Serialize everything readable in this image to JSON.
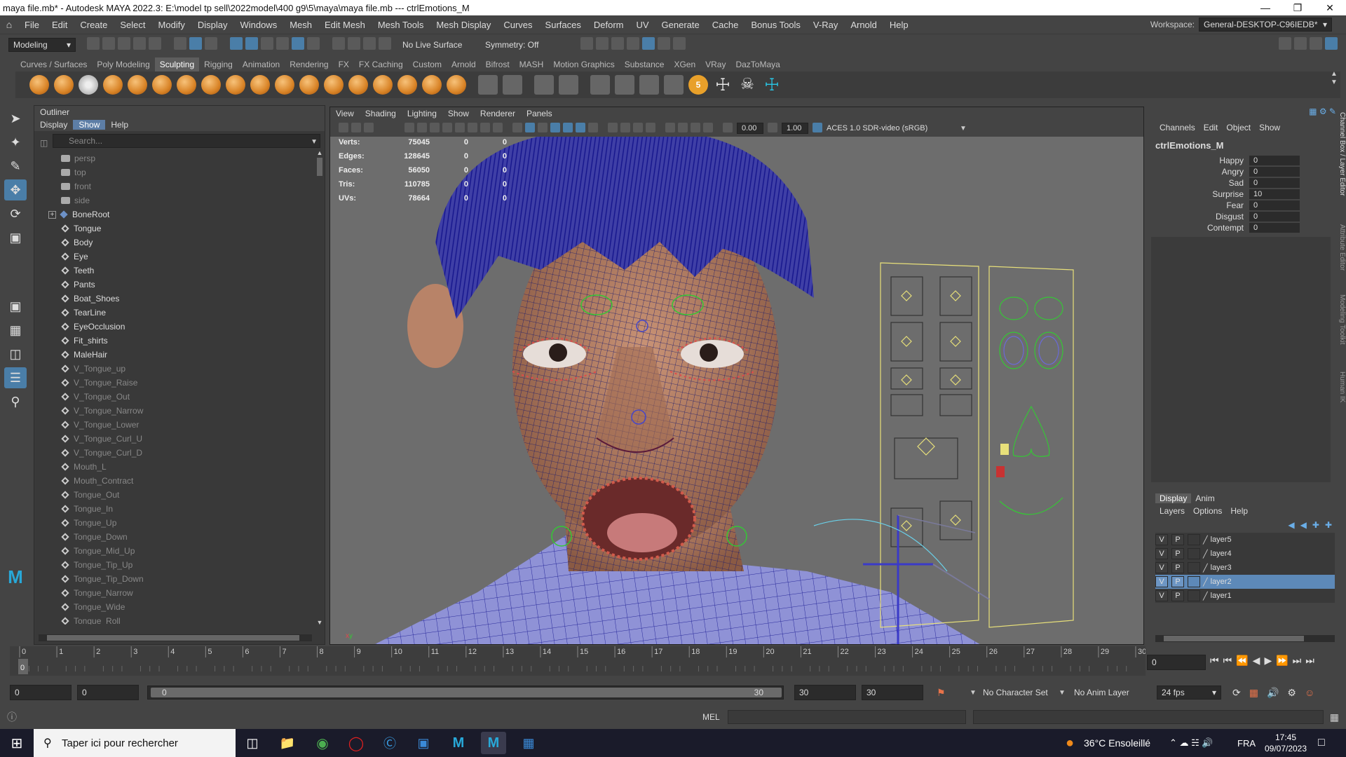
{
  "window": {
    "title": "maya file.mb* - Autodesk MAYA 2022.3: E:\\model tp sell\\2022model\\400 g9\\5\\maya\\maya file.mb   ---   ctrlEmotions_M"
  },
  "menubar": {
    "items": [
      "File",
      "Edit",
      "Create",
      "Select",
      "Modify",
      "Display",
      "Windows",
      "Mesh",
      "Edit Mesh",
      "Mesh Tools",
      "Mesh Display",
      "Curves",
      "Surfaces",
      "Deform",
      "UV",
      "Generate",
      "Cache",
      "Bonus Tools",
      "V-Ray",
      "Arnold",
      "Help"
    ],
    "workspace_label": "Workspace:",
    "workspace_value": "General-DESKTOP-C96IEDB*"
  },
  "statusline": {
    "mode": "Modeling",
    "live_surface": "No Live Surface",
    "symmetry": "Symmetry: Off"
  },
  "shelf": {
    "tabs": [
      "Curves / Surfaces",
      "Poly Modeling",
      "Sculpting",
      "Rigging",
      "Animation",
      "Rendering",
      "FX",
      "FX Caching",
      "Custom",
      "Arnold",
      "Bifrost",
      "MASH",
      "Motion Graphics",
      "Substance",
      "XGen",
      "VRay",
      "DazToMaya"
    ],
    "active_tab": "Sculpting"
  },
  "outliner": {
    "title": "Outliner",
    "menu": [
      "Display",
      "Show",
      "Help"
    ],
    "active_menu": "Show",
    "search_placeholder": "Search...",
    "items": [
      {
        "name": "persp",
        "type": "cam",
        "dim": true
      },
      {
        "name": "top",
        "type": "cam",
        "dim": true
      },
      {
        "name": "front",
        "type": "cam",
        "dim": true
      },
      {
        "name": "side",
        "type": "cam",
        "dim": true
      },
      {
        "name": "BoneRoot",
        "type": "bone",
        "dim": false,
        "expand": true
      },
      {
        "name": "Tongue",
        "type": "mesh",
        "dim": false
      },
      {
        "name": "Body",
        "type": "mesh",
        "dim": false
      },
      {
        "name": "Eye",
        "type": "mesh",
        "dim": false
      },
      {
        "name": "Teeth",
        "type": "mesh",
        "dim": false
      },
      {
        "name": "Pants",
        "type": "mesh",
        "dim": false
      },
      {
        "name": "Boat_Shoes",
        "type": "mesh",
        "dim": false
      },
      {
        "name": "TearLine",
        "type": "mesh",
        "dim": false
      },
      {
        "name": "EyeOcclusion",
        "type": "mesh",
        "dim": false
      },
      {
        "name": "Fit_shirts",
        "type": "mesh",
        "dim": false
      },
      {
        "name": "MaleHair",
        "type": "mesh",
        "dim": false
      },
      {
        "name": "V_Tongue_up",
        "type": "mesh",
        "dim": true
      },
      {
        "name": "V_Tongue_Raise",
        "type": "mesh",
        "dim": true
      },
      {
        "name": "V_Tongue_Out",
        "type": "mesh",
        "dim": true
      },
      {
        "name": "V_Tongue_Narrow",
        "type": "mesh",
        "dim": true
      },
      {
        "name": "V_Tongue_Lower",
        "type": "mesh",
        "dim": true
      },
      {
        "name": "V_Tongue_Curl_U",
        "type": "mesh",
        "dim": true
      },
      {
        "name": "V_Tongue_Curl_D",
        "type": "mesh",
        "dim": true
      },
      {
        "name": "Mouth_L",
        "type": "mesh",
        "dim": true
      },
      {
        "name": "Mouth_Contract",
        "type": "mesh",
        "dim": true
      },
      {
        "name": "Tongue_Out",
        "type": "mesh",
        "dim": true
      },
      {
        "name": "Tongue_In",
        "type": "mesh",
        "dim": true
      },
      {
        "name": "Tongue_Up",
        "type": "mesh",
        "dim": true
      },
      {
        "name": "Tongue_Down",
        "type": "mesh",
        "dim": true
      },
      {
        "name": "Tongue_Mid_Up",
        "type": "mesh",
        "dim": true
      },
      {
        "name": "Tongue_Tip_Up",
        "type": "mesh",
        "dim": true
      },
      {
        "name": "Tongue_Tip_Down",
        "type": "mesh",
        "dim": true
      },
      {
        "name": "Tongue_Narrow",
        "type": "mesh",
        "dim": true
      },
      {
        "name": "Tongue_Wide",
        "type": "mesh",
        "dim": true
      },
      {
        "name": "Tongue_Roll",
        "type": "mesh",
        "dim": true
      }
    ]
  },
  "viewport": {
    "menu": [
      "View",
      "Shading",
      "Lighting",
      "Show",
      "Renderer",
      "Panels"
    ],
    "exposure": "0.00",
    "gamma": "1.00",
    "color_space": "ACES 1.0 SDR-video (sRGB)",
    "hud": [
      {
        "label": "Verts:",
        "value": "75045",
        "a": "0",
        "b": "0"
      },
      {
        "label": "Edges:",
        "value": "128645",
        "a": "0",
        "b": "0"
      },
      {
        "label": "Faces:",
        "value": "56050",
        "a": "0",
        "b": "0"
      },
      {
        "label": "Tris:",
        "value": "110785",
        "a": "0",
        "b": "0"
      },
      {
        "label": "UVs:",
        "value": "78664",
        "a": "0",
        "b": "0"
      }
    ]
  },
  "channelbox": {
    "menu": [
      "Channels",
      "Edit",
      "Object",
      "Show"
    ],
    "object": "ctrlEmotions_M",
    "attributes": [
      {
        "name": "Happy",
        "value": "0"
      },
      {
        "name": "Angry",
        "value": "0"
      },
      {
        "name": "Sad",
        "value": "0"
      },
      {
        "name": "Surprise",
        "value": "10"
      },
      {
        "name": "Fear",
        "value": "0"
      },
      {
        "name": "Disgust",
        "value": "0"
      },
      {
        "name": "Contempt",
        "value": "0"
      }
    ],
    "side_tabs": [
      "Channel Box / Layer Editor",
      "Attribute Editor",
      "Modeling Toolkit",
      "Human IK"
    ]
  },
  "layer_editor": {
    "tabs": [
      "Display",
      "Anim"
    ],
    "active_tab": "Display",
    "menu": [
      "Layers",
      "Options",
      "Help"
    ],
    "layers": [
      {
        "v": "V",
        "p": "P",
        "name": "layer5",
        "selected": false
      },
      {
        "v": "V",
        "p": "P",
        "name": "layer4",
        "selected": false
      },
      {
        "v": "V",
        "p": "P",
        "name": "layer3",
        "selected": false
      },
      {
        "v": "V",
        "p": "P",
        "name": "layer2",
        "selected": true
      },
      {
        "v": "V",
        "p": "P",
        "name": "layer1",
        "selected": false
      }
    ]
  },
  "timeline": {
    "ticks": [
      "0",
      "1",
      "2",
      "3",
      "4",
      "5",
      "6",
      "7",
      "8",
      "9",
      "10",
      "11",
      "12",
      "13",
      "14",
      "15",
      "16",
      "17",
      "18",
      "19",
      "20",
      "21",
      "22",
      "23",
      "24",
      "25",
      "26",
      "27",
      "28",
      "29",
      "30"
    ],
    "current_frame_marker": "0",
    "current_frame": "0"
  },
  "range": {
    "start": "0",
    "anim_start": "0",
    "slider_start": "0",
    "slider_end": "30",
    "playback_end": "30",
    "anim_end": "30",
    "character_set": "No Character Set",
    "anim_layer": "No Anim Layer",
    "fps": "24 fps"
  },
  "cmdline": {
    "lang": "MEL"
  },
  "taskbar": {
    "search_placeholder": "Taper ici pour rechercher",
    "weather": "36°C  Ensoleillé",
    "lang": "FRA",
    "time": "17:45",
    "date": "09/07/2023"
  },
  "colors": {
    "accent": "#4a7ea8",
    "wire": "#1a1a8c",
    "control_yellow": "#e8e07a",
    "control_green": "#35c735"
  }
}
